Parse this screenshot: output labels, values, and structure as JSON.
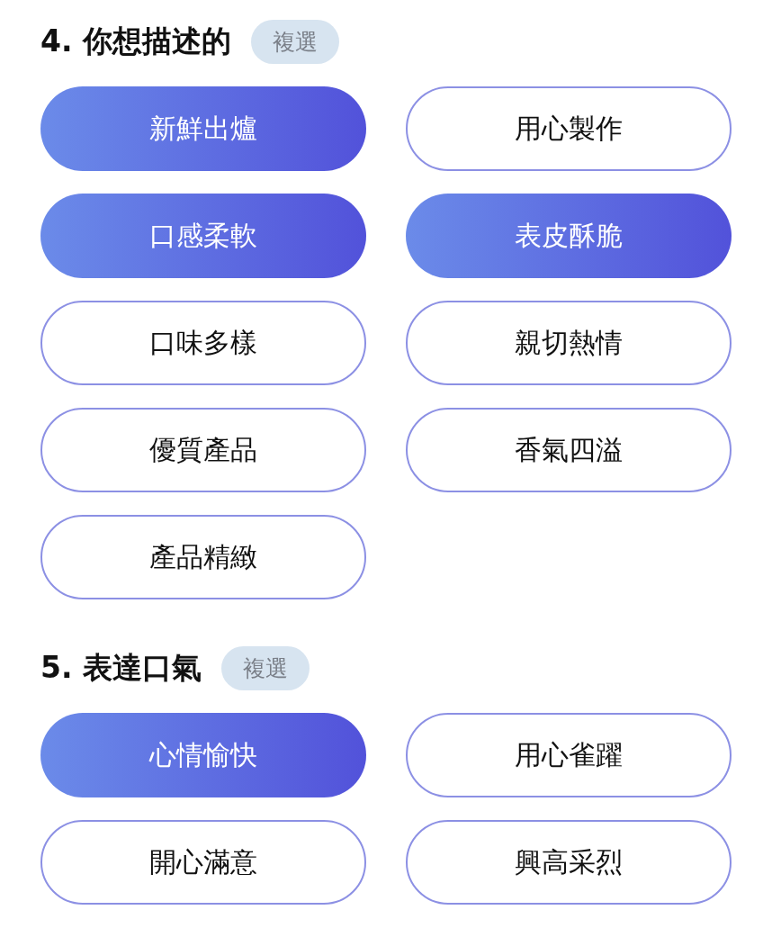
{
  "sections": [
    {
      "title": "4. 你想描述的",
      "badge": "複選",
      "options": [
        {
          "label": "新鮮出爐",
          "selected": true
        },
        {
          "label": "用心製作",
          "selected": false
        },
        {
          "label": "口感柔軟",
          "selected": true
        },
        {
          "label": "表皮酥脆",
          "selected": true
        },
        {
          "label": "口味多樣",
          "selected": false
        },
        {
          "label": "親切熱情",
          "selected": false
        },
        {
          "label": "優質產品",
          "selected": false
        },
        {
          "label": "香氣四溢",
          "selected": false
        },
        {
          "label": "產品精緻",
          "selected": false
        }
      ]
    },
    {
      "title": "5. 表達口氣",
      "badge": "複選",
      "options": [
        {
          "label": "心情愉快",
          "selected": true
        },
        {
          "label": "用心雀躍",
          "selected": false
        },
        {
          "label": "開心滿意",
          "selected": false
        },
        {
          "label": "興高采烈",
          "selected": false
        }
      ]
    }
  ]
}
